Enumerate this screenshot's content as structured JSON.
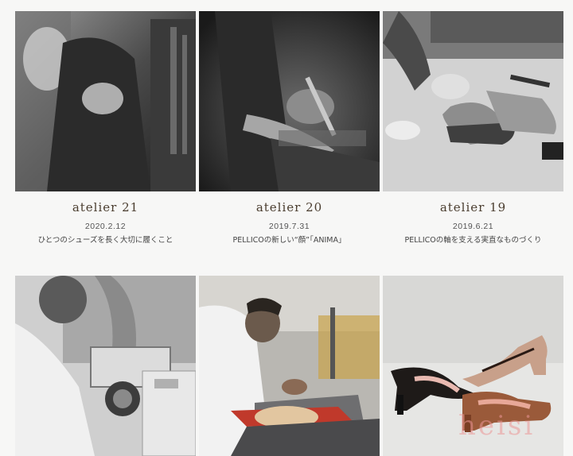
{
  "posts": [
    {
      "title": "atelier 21",
      "date": "2020.2.12",
      "subtitle": "ひとつのシューズを長く大切に履くこと"
    },
    {
      "title": "atelier 20",
      "date": "2019.7.31",
      "subtitle": "PELLICOの新しい“顔”「ANIMA」"
    },
    {
      "title": "atelier 19",
      "date": "2019.6.21",
      "subtitle": "PELLICOの軸を支える実直なものづくり"
    }
  ],
  "watermark": "heisi"
}
